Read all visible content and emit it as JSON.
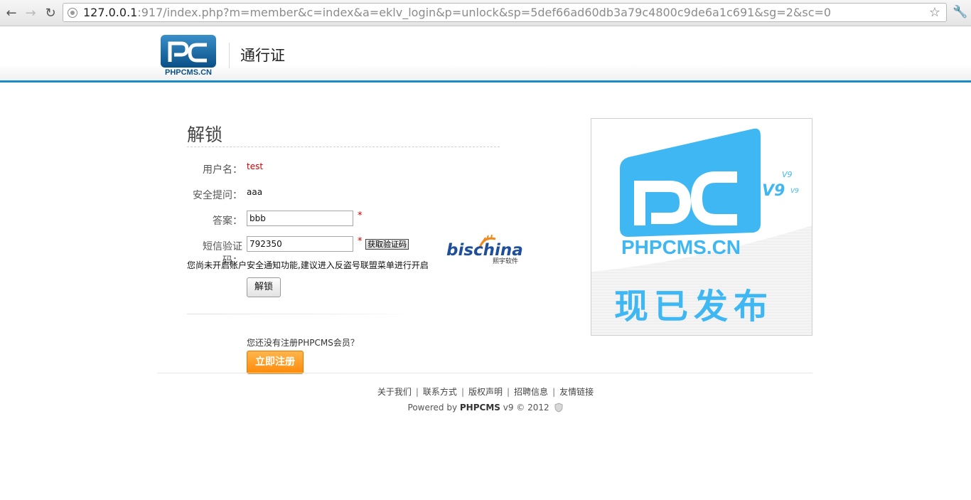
{
  "browser": {
    "url_host": "127.0.0.1",
    "url_rest": ":917/index.php?m=member&c=index&a=eklv_login&p=unlock&sp=5def66ad60db3a79c4800c9de6a1c691&sg=2&sc=0"
  },
  "header": {
    "logo_text": "PHPCMS.CN",
    "title": "通行证"
  },
  "form": {
    "page_title": "解锁",
    "username_label": "用户名：",
    "username_value": "test",
    "question_label": "安全提问：",
    "question_value": "aaa",
    "answer_label": "答案：",
    "answer_value": "bbb",
    "sms_label": "短信验证码：",
    "sms_value": "792350",
    "required_mark": "*",
    "get_code_label": "获取验证码",
    "notice": "您尚未开启账户安全通知功能,建议进入反盗号联盟菜单进行开启",
    "unlock_label": "解锁",
    "no_account": "您还没有注册PHPCMS会员？",
    "register_label": "立即注册"
  },
  "partner": {
    "name": "bischina",
    "sub": "熙宇软件"
  },
  "promo": {
    "brand": "PHPCMS.CN",
    "version": "V9",
    "tagline": "现已发布"
  },
  "footer": {
    "links": [
      "关于我们",
      "联系方式",
      "版权声明",
      "招聘信息",
      "友情链接"
    ],
    "powered_prefix": "Powered by ",
    "powered_brand": "PHPCMS",
    "powered_suffix": " v9 © 2012"
  }
}
